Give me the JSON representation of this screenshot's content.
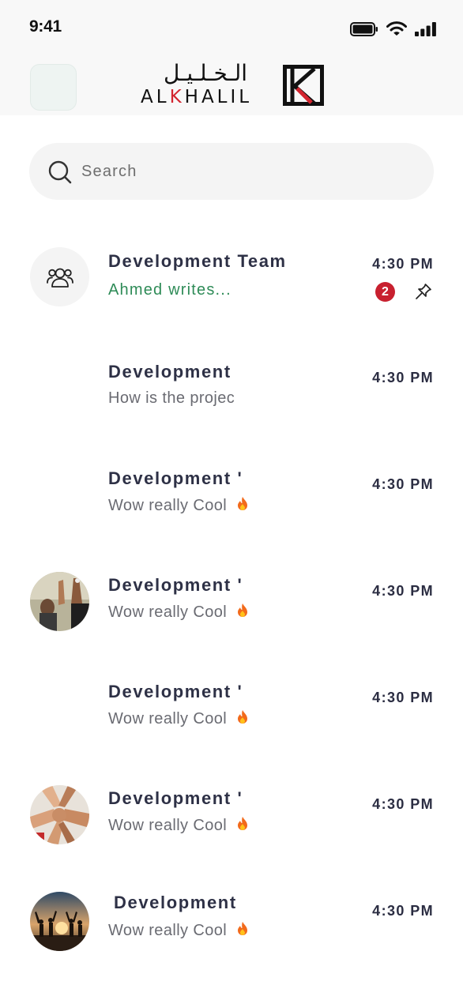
{
  "status_bar": {
    "time": "9:41",
    "battery_icon": "battery-icon",
    "wifi_icon": "wifi-icon",
    "signal_icon": "signal-icon"
  },
  "header": {
    "logo_arabic": "الـخـلـيـل",
    "logo_latin_prefix": "AL",
    "logo_latin_k": "K",
    "logo_latin_suffix": "HALIL",
    "logo_mark_icon": "alkhalil-logo-mark",
    "brand_red": "#d3252f"
  },
  "search": {
    "placeholder": "Search",
    "value": "",
    "icon": "search-icon"
  },
  "chats": [
    {
      "title": "Development Team",
      "preview": "Ahmed writes...",
      "time": "4:30 PM",
      "unread": "2",
      "pinned": true,
      "avatar": "group-icon"
    },
    {
      "title": "Development",
      "preview": "How is the projec",
      "time": "4:30 PM"
    },
    {
      "title": "Development '",
      "preview": "Wow really Cool",
      "time": "4:30 PM",
      "emoji": "fire-icon"
    },
    {
      "title": "Development '",
      "preview": "Wow really Cool",
      "time": "4:30 PM",
      "emoji": "fire-icon",
      "avatar": "photo-people-celebrating"
    },
    {
      "title": "Development '",
      "preview": "Wow really Cool",
      "time": "4:30 PM",
      "emoji": "fire-icon"
    },
    {
      "title": "Development '",
      "preview": "Wow really Cool",
      "time": "4:30 PM",
      "emoji": "fire-icon",
      "avatar": "photo-fist-bump"
    },
    {
      "title": "Development",
      "preview": "Wow really Cool",
      "time": "4:30 PM",
      "emoji": "fire-icon",
      "avatar": "photo-sunset-silhouettes"
    }
  ],
  "colors": {
    "accent_green": "#2e8b57",
    "badge_red": "#c8202f",
    "title_navy": "#2e3146"
  }
}
